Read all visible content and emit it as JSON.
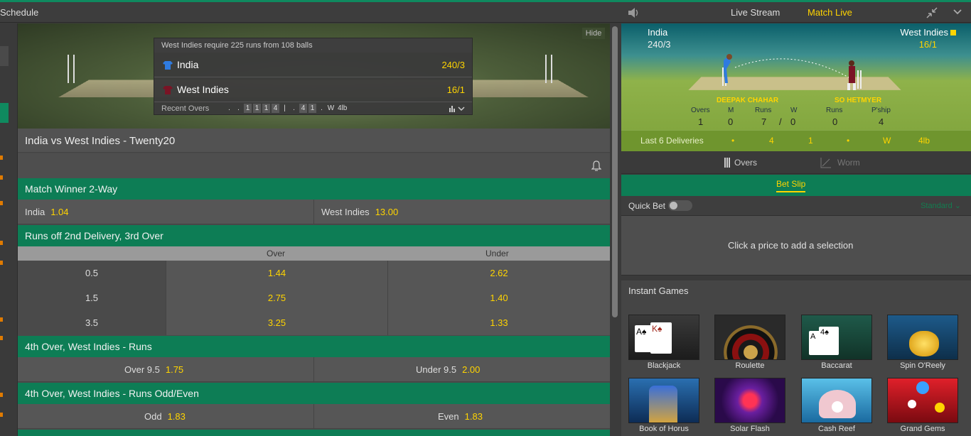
{
  "topbar": {
    "schedule_label": "Schedule",
    "live_stream_label": "Live Stream",
    "match_live_label": "Match Live"
  },
  "scoreboard": {
    "hide_label": "Hide",
    "requirement": "West Indies require 225 runs from 108 balls",
    "teams": [
      {
        "name": "India",
        "score": "240/3",
        "shirt_color": "#2f7be0"
      },
      {
        "name": "West Indies",
        "score": "16/1",
        "shirt_color": "#7a1425"
      }
    ],
    "recent_overs_label": "Recent Overs",
    "recent_balls": [
      ".",
      ".",
      "1",
      "1",
      "1",
      "4",
      "|",
      ".",
      "4",
      "1",
      ".",
      "W",
      "4lb"
    ]
  },
  "match": {
    "title": "India vs West Indies - Twenty20"
  },
  "markets": {
    "winner": {
      "title": "Match Winner 2-Way",
      "selections": [
        {
          "label": "India",
          "odds": "1.04"
        },
        {
          "label": "West Indies",
          "odds": "13.00"
        }
      ]
    },
    "runs_delivery": {
      "title": "Runs off 2nd Delivery, 3rd Over",
      "col_over": "Over",
      "col_under": "Under",
      "rows": [
        {
          "line": "0.5",
          "over": "1.44",
          "under": "2.62"
        },
        {
          "line": "1.5",
          "over": "2.75",
          "under": "1.40"
        },
        {
          "line": "3.5",
          "over": "3.25",
          "under": "1.33"
        }
      ]
    },
    "over_runs": {
      "title": "4th Over, West Indies - Runs",
      "selections": [
        {
          "label": "Over 9.5",
          "odds": "1.75"
        },
        {
          "label": "Under 9.5",
          "odds": "2.00"
        }
      ]
    },
    "odd_even": {
      "title": "4th Over, West Indies - Runs Odd/Even",
      "selections": [
        {
          "label": "Odd",
          "odds": "1.83"
        },
        {
          "label": "Even",
          "odds": "1.83"
        }
      ]
    }
  },
  "live_panel": {
    "left_team": "India",
    "left_score": "240/3",
    "right_team": "West Indies",
    "right_score": "16/1",
    "bowler": "DEEPAK CHAHAR",
    "batsman": "SO HETMYER",
    "bowler_stats": {
      "labels": [
        "Overs",
        "M",
        "Runs",
        "W"
      ],
      "values": [
        "1",
        "0",
        "7",
        "0"
      ],
      "separator": "/"
    },
    "batsman_stats": {
      "labels": [
        "Runs",
        "P'ship"
      ],
      "values": [
        "0",
        "4"
      ]
    },
    "last6_label": "Last 6 Deliveries",
    "last6": [
      "•",
      "4",
      "1",
      "•",
      "W",
      "4lb"
    ],
    "overs_label": "Overs",
    "worm_label": "Worm"
  },
  "betslip": {
    "title": "Bet Slip",
    "quick_bet_label": "Quick Bet",
    "standard_label": "Standard",
    "empty_message": "Click a price to add a selection"
  },
  "instant_games": {
    "title": "Instant Games",
    "games": [
      "Blackjack",
      "Roulette",
      "Baccarat",
      "Spin O'Reely",
      "Book of Horus",
      "Solar Flash",
      "Cash Reef",
      "Grand Gems"
    ]
  },
  "colors": {
    "accent_green": "#0d7d55",
    "odds_yellow": "#ffd400"
  }
}
